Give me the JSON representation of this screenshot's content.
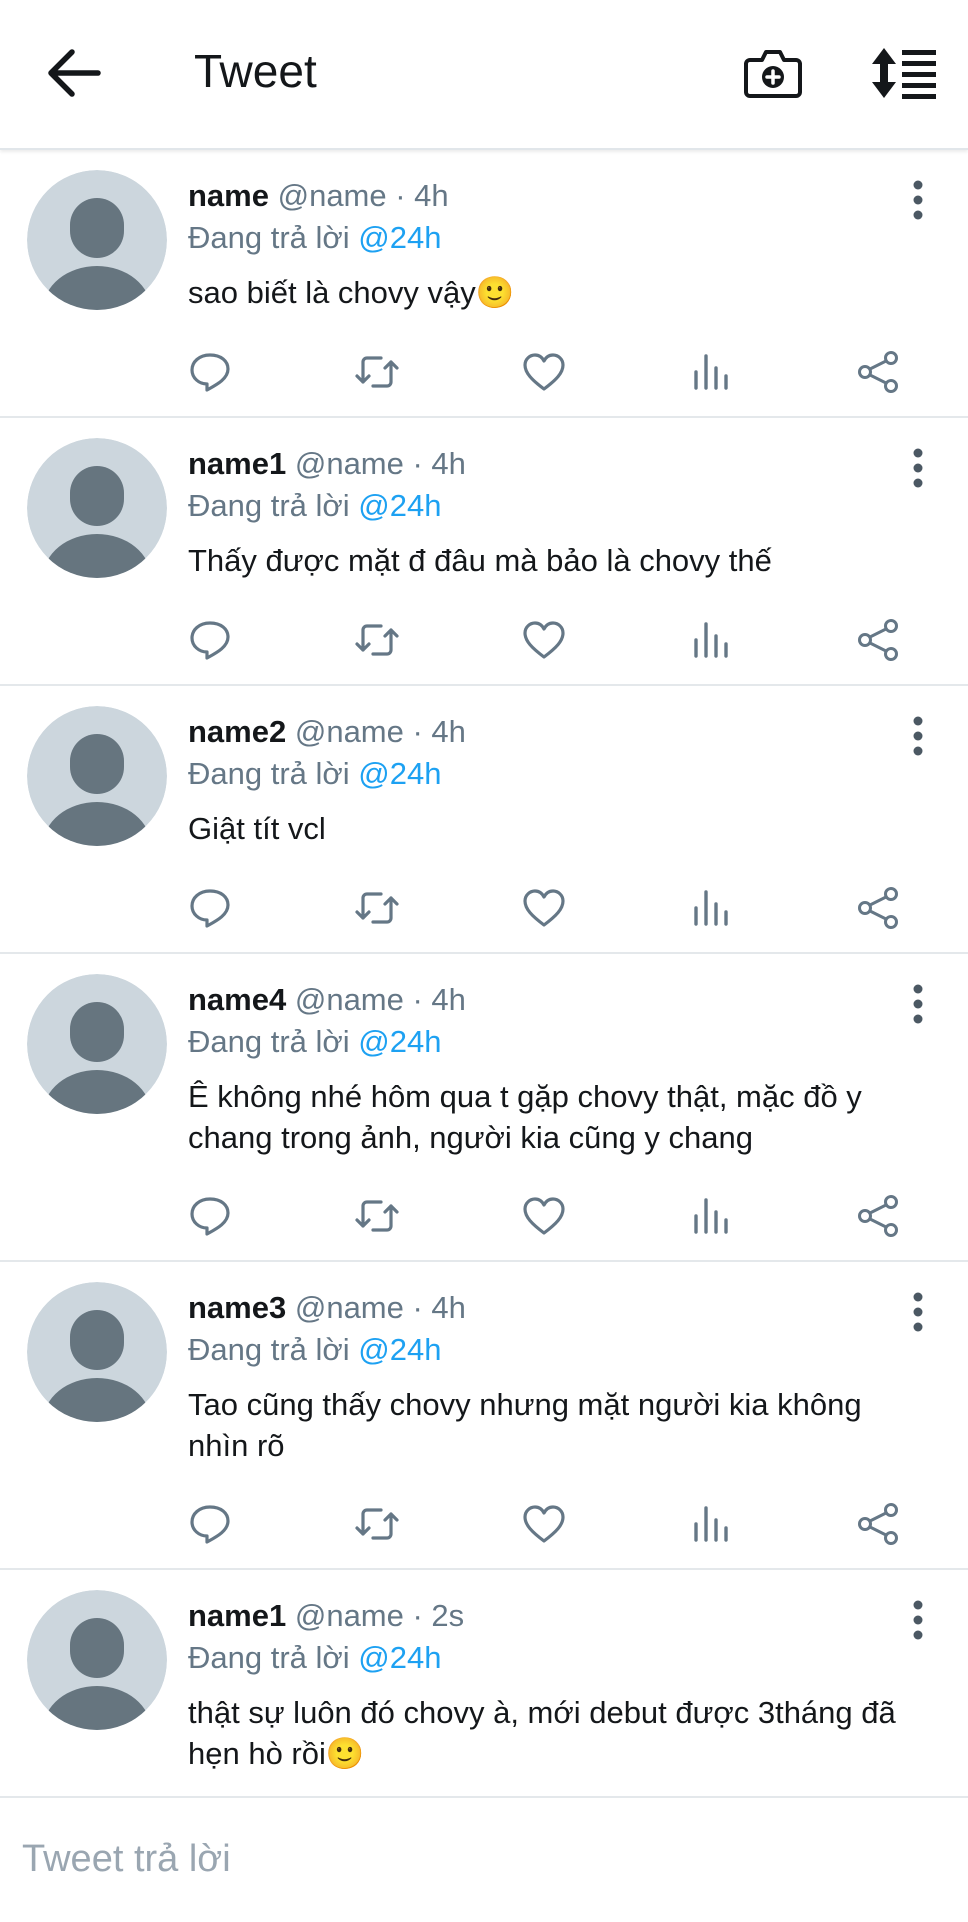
{
  "header": {
    "title": "Tweet",
    "back_icon": "arrow-left-icon",
    "camera_icon": "camera-plus-icon",
    "sort_icon": "sort-icon"
  },
  "colors": {
    "mention": "#1da1f2",
    "secondary_text": "#657786",
    "avatar_bg": "#ccd6dd",
    "avatar_fg": "#66757f"
  },
  "tweets": [
    {
      "name": "name",
      "meta": "@name · 4h",
      "reply_prefix": "Đang trả lời",
      "reply_to": "@24h",
      "text": "sao biết là chovy vậy🙂"
    },
    {
      "name": "name1",
      "meta": "@name · 4h",
      "reply_prefix": "Đang trả lời",
      "reply_to": "@24h",
      "text": "Thấy được mặt đ đâu mà bảo là chovy thế"
    },
    {
      "name": "name2",
      "meta": "@name · 4h",
      "reply_prefix": "Đang trả lời",
      "reply_to": "@24h",
      "text": "Giật tít vcl"
    },
    {
      "name": "name4",
      "meta": "@name · 4h",
      "reply_prefix": "Đang trả lời",
      "reply_to": "@24h",
      "text": "Ê không nhé hôm qua t gặp chovy thật, mặc đồ y chang trong ảnh, người kia cũng y chang"
    },
    {
      "name": "name3",
      "meta": "@name · 4h",
      "reply_prefix": "Đang trả lời",
      "reply_to": "@24h",
      "text": "Tao cũng thấy chovy nhưng mặt người kia không nhìn rõ"
    },
    {
      "name": "name1",
      "meta": "@name · 2s",
      "reply_prefix": "Đang trả lời",
      "reply_to": "@24h",
      "text": "thật sự luôn đó chovy à, mới debut được 3tháng đã hẹn hò rồi🙂"
    }
  ],
  "action_icons": [
    "reply-icon",
    "retweet-icon",
    "like-icon",
    "analytics-icon",
    "share-icon"
  ],
  "composer": {
    "placeholder": "Tweet trả lời"
  }
}
